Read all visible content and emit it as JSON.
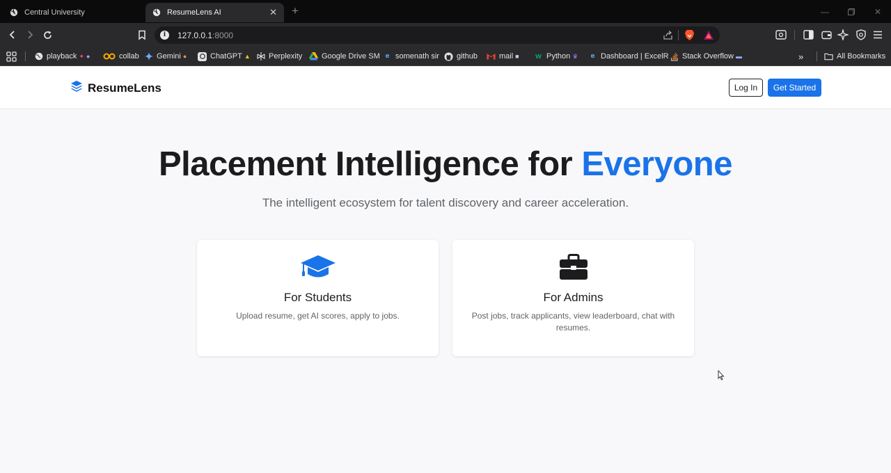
{
  "browser": {
    "tabs": [
      {
        "title": "Central University",
        "active": false
      },
      {
        "title": "ResumeLens AI",
        "active": true
      }
    ],
    "url": {
      "host": "127.0.0.1",
      "port": ":8000"
    },
    "bookmarks": [
      {
        "label": "playback",
        "icon": "globe-icon"
      },
      {
        "label": "collab",
        "icon": "colab-icon"
      },
      {
        "label": "Gemini",
        "icon": "gemini-icon"
      },
      {
        "label": "ChatGPT",
        "icon": "chatgpt-icon"
      },
      {
        "label": "Perplexity",
        "icon": "perplexity-icon"
      },
      {
        "label": "Google Drive SM",
        "icon": "google-drive-icon"
      },
      {
        "label": "somenath sir",
        "icon": "edge-icon"
      },
      {
        "label": "github",
        "icon": "github-icon"
      },
      {
        "label": "mail",
        "icon": "gmail-icon"
      },
      {
        "label": "Python",
        "icon": "w3schools-icon"
      },
      {
        "label": "Dashboard | ExcelR",
        "icon": "edge-icon"
      },
      {
        "label": "Stack Overflow",
        "icon": "stackoverflow-icon"
      }
    ],
    "all_bookmarks_label": "All Bookmarks"
  },
  "site": {
    "brand": "ResumeLens",
    "login_label": "Log In",
    "get_started_label": "Get Started",
    "accent_color": "#1a73e8"
  },
  "hero": {
    "title_prefix": "Placement Intelligence for ",
    "title_accent": "Everyone",
    "subtitle": "The intelligent ecosystem for talent discovery and career acceleration."
  },
  "cards": [
    {
      "icon": "graduation-cap-icon",
      "title": "For Students",
      "description": "Upload resume, get AI scores, apply to jobs."
    },
    {
      "icon": "briefcase-icon",
      "title": "For Admins",
      "description": "Post jobs, track applicants, view leaderboard, chat with resumes."
    }
  ]
}
